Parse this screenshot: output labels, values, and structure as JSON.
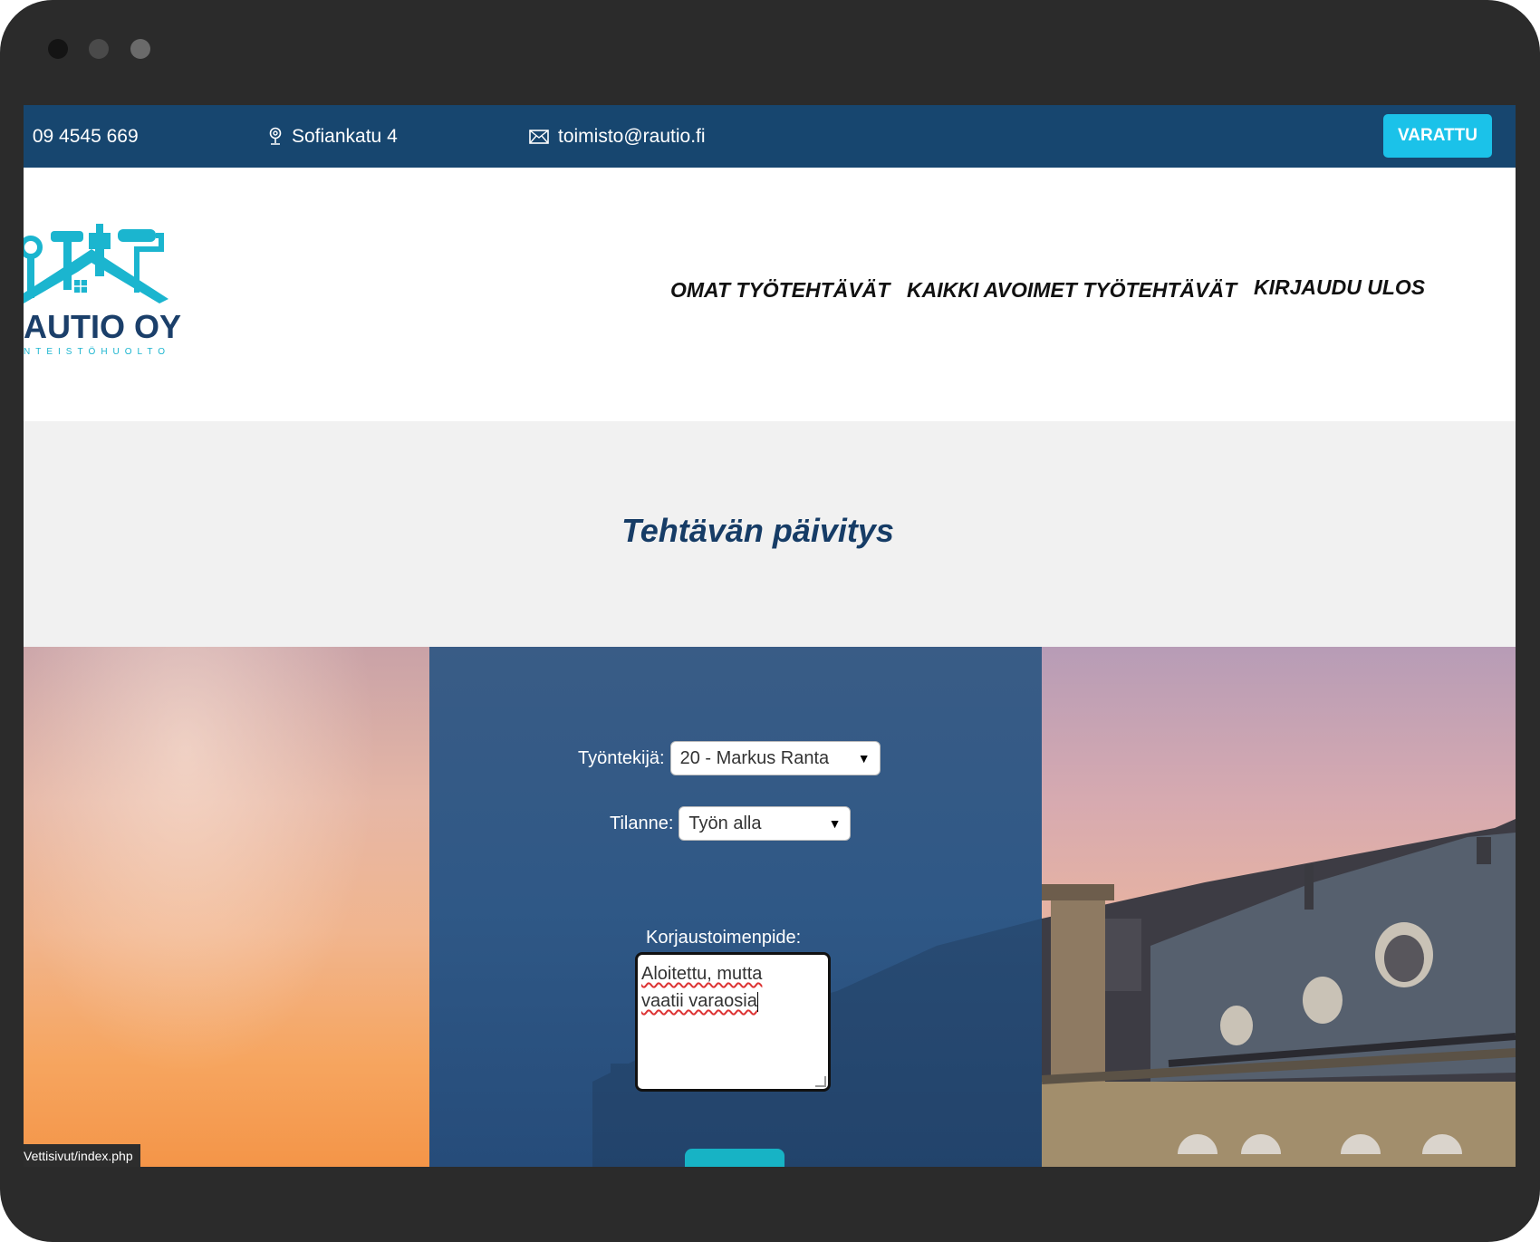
{
  "topbar": {
    "phone": "09 4545 669",
    "address": "Sofiankatu 4",
    "email": "toimisto@rautio.fi",
    "status_button": "VARATTU",
    "bg_color": "#17466f",
    "button_color": "#1bc2e9"
  },
  "brand": {
    "name": "AUTIO OY",
    "tagline": "NTEISTÖHUOLTO",
    "logo_color": "#1bb5cf"
  },
  "nav": {
    "items": [
      {
        "label": "OMAT TYÖTEHTÄVÄT"
      },
      {
        "label": "KAIKKI AVOIMET TYÖTEHTÄVÄT"
      },
      {
        "label": "KIRJAUDU ULOS"
      }
    ]
  },
  "page": {
    "title": "Tehtävän päivitys",
    "title_color": "#163c66"
  },
  "form": {
    "employee_label": "Työntekijä:",
    "employee_value": "20 - Markus Ranta",
    "status_label": "Tilanne:",
    "status_value": "Työn alla",
    "action_label": "Korjaustoimenpide:",
    "action_lines": [
      "Aloitettu, mutta",
      "vaatii varaosia"
    ]
  },
  "statusbar": {
    "url": "Vettisivut/index.php"
  }
}
